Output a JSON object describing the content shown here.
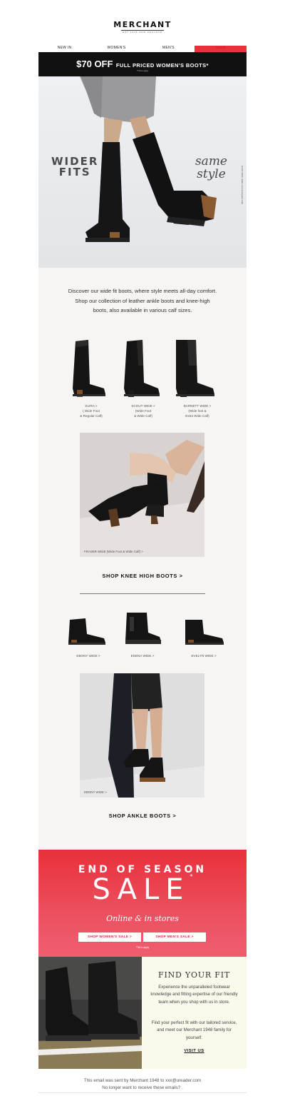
{
  "header": {
    "logo": "MERCHANT",
    "logo_sub": "EST 1948 NEW ZEALAND"
  },
  "nav": {
    "items": [
      "NEW IN",
      "WOMEN'S",
      "MEN'S",
      "SALE"
    ]
  },
  "promo": {
    "amount": "$70 OFF",
    "text": "FULL PRICED WOMEN'S BOOTS*",
    "tc": "*T&Cs apply"
  },
  "hero": {
    "left_text": "WIDER\nFITS",
    "right_text": "same\nstyle",
    "caption": "ELIRA WIDE (Wide Foot & Regular Calf)"
  },
  "intro": "Discover our wide fit boots, where style meets all-day comfort. Shop our collection of leather ankle boots and knee-high boots, also available in various calf sizes.",
  "knee_high": [
    {
      "label": "ELIRA >\n( Wide Foot\n& Regular Calf)"
    },
    {
      "label": "SCOUT WIDE >\n(Wide Foot\n& Wide Calf)"
    },
    {
      "label": "BARNETT WIDE >\n(Wide foot &\nExtra Wide Calf)"
    }
  ],
  "lifestyle1_caption": "FRASER WIDE (Wide Foot & Wide Calf) >",
  "cta_knee": "SHOP KNEE HIGH BOOTS >",
  "ankle": [
    {
      "label": "EBONY WIDE >"
    },
    {
      "label": "EDENA WIDE >"
    },
    {
      "label": "EVELYN WIDE >"
    }
  ],
  "lifestyle2_caption": "EBONY WIDE >",
  "cta_ankle": "SHOP ANKLE BOOTS >",
  "sale": {
    "eyebrow": "END OF SEASON",
    "headline": "SALE",
    "star": "*",
    "subtitle": "Online & in stores",
    "btn_women": "SHOP WOMEN'S SALE >",
    "btn_men": "SHOP MEN'S SALE >",
    "tc": "*T&Cs apply"
  },
  "fit": {
    "title": "FIND YOUR FIT",
    "p1": "Experience the unparalleled footwear knowledge and fitting expertise of our friendly team when you shop with us in store.",
    "p2": "Find your perfect fit with our tailored service, and meet our Merchant 1948 family for yourself.",
    "link": "VISIT US"
  },
  "footer": {
    "line1": "This email was sent by Merchant 1948 to xxx@ureader.com",
    "line2": "No longer want to receive these emails? ."
  },
  "colors": {
    "sale_red": "#e8303a",
    "nav_sale": "#d81e2a",
    "panel_bg": "#f6f5f3",
    "fit_bg": "#fbf8ec"
  }
}
